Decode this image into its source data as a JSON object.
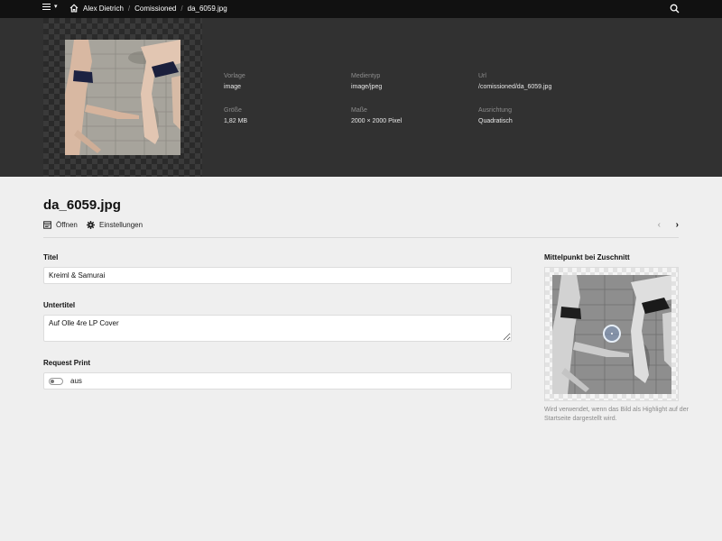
{
  "breadcrumb": {
    "items": [
      "Alex Dietrich",
      "Comissioned",
      "da_6059.jpg"
    ],
    "separator": "/"
  },
  "file": {
    "meta": [
      {
        "label": "Vorlage",
        "value": "image"
      },
      {
        "label": "Medientyp",
        "value": "image/jpeg"
      },
      {
        "label": "Url",
        "value": "/comissioned/da_6059.jpg"
      },
      {
        "label": "Größe",
        "value": "1,82 MB"
      },
      {
        "label": "Maße",
        "value": "2000 × 2000 Pixel"
      },
      {
        "label": "Ausrichtung",
        "value": "Quadratisch"
      }
    ]
  },
  "page": {
    "title": "da_6059.jpg",
    "open_label": "Öffnen",
    "settings_label": "Einstellungen"
  },
  "form": {
    "title_label": "Titel",
    "title_value": "Kreiml & Samurai",
    "subtitle_label": "Untertitel",
    "subtitle_value": "Auf Olle 4re LP Cover",
    "print_label": "Request Print",
    "print_state": "aus"
  },
  "focus": {
    "label": "Mittelpunkt bei Zuschnitt",
    "help": "Wird verwendet, wenn das Bild als Highlight auf der Startseite dargestellt wird."
  },
  "icons": {
    "menu": "hamburger-icon",
    "home": "home-icon",
    "search": "search-icon",
    "open": "window-icon",
    "settings": "gear-icon",
    "prev": "chevron-left-icon",
    "next": "chevron-right-icon"
  },
  "colors": {
    "topbar": "#111111",
    "header": "#313131",
    "background": "#efefef"
  }
}
